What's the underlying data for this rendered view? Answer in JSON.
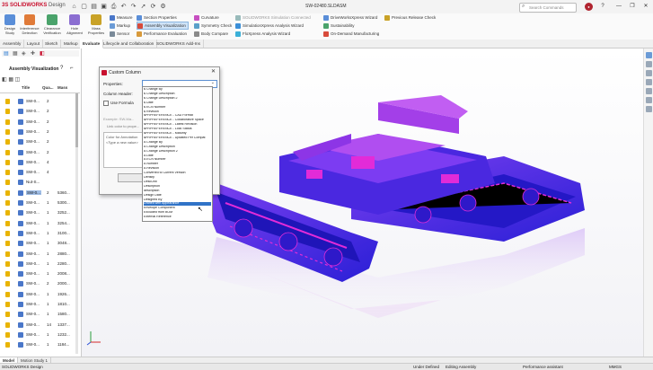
{
  "app": {
    "logo_ds": "3S",
    "logo_name": "SOLIDWORKS",
    "logo_suffix": "Design",
    "doc_title": "SW-02480.SLDASM",
    "search_placeholder": "Search Commands",
    "window_controls": [
      "—",
      "❐",
      "✕"
    ],
    "quick_icons": [
      "home-icon",
      "new-icon",
      "open-icon",
      "save-icon",
      "print-icon",
      "undo-icon",
      "redo-icon",
      "select-icon",
      "rebuild-icon",
      "options-icon"
    ]
  },
  "ribbon": {
    "big_buttons": [
      {
        "label": "Design Study",
        "color": "#5a8ed8"
      },
      {
        "label": "Interference Detection",
        "color": "#e07b39"
      },
      {
        "label": "Clearance Verification",
        "color": "#4aa36b"
      },
      {
        "label": "Hole Alignment",
        "color": "#8b6ed1"
      },
      {
        "label": "Mass Properties",
        "color": "#c9a227"
      }
    ],
    "col1": [
      "Measure",
      "Markup",
      "Sensor"
    ],
    "col2": [
      "Section Properties",
      "Assembly Visualization",
      "Performance Evaluation"
    ],
    "col3": [
      "Curvature",
      "Symmetry Check",
      "Body Compare"
    ],
    "col4": [
      "SOLIDWORKS Simulation Connected",
      "SimulationXpress Analysis Wizard",
      "FloXpress Analysis Wizard"
    ],
    "col5": [
      "DriveWorksXpress Wizard",
      "Sustainability",
      "On-Demand Manufacturing"
    ],
    "col6": [
      "Previous Release Check"
    ],
    "highlight": "Assembly Visualization"
  },
  "tabs": [
    "Assembly",
    "Layout",
    "Sketch",
    "Markup",
    "Evaluate",
    "Lifecycle and Collaboration",
    "SOLIDWORKS Add-Ins"
  ],
  "active_tab": "Evaluate",
  "left_panel": {
    "title": "Assembly Visualization",
    "headers": [
      "Title",
      "Qua...",
      "Mass"
    ],
    "rows": [
      {
        "name": "SW-0...",
        "qty": "2",
        "mass": ""
      },
      {
        "name": "SW-0...",
        "qty": "2",
        "mass": ""
      },
      {
        "name": "SW-0...",
        "qty": "2",
        "mass": ""
      },
      {
        "name": "SW-0...",
        "qty": "2",
        "mass": ""
      },
      {
        "name": "SW-0...",
        "qty": "2",
        "mass": ""
      },
      {
        "name": "SW-0...",
        "qty": "2",
        "mass": ""
      },
      {
        "name": "SW-0...",
        "qty": "4",
        "mass": ""
      },
      {
        "name": "SW-0...",
        "qty": "4",
        "mass": ""
      },
      {
        "name": "Nut-S...",
        "qty": "",
        "mass": ""
      },
      {
        "name": "SW-0...",
        "qty": "2",
        "mass": "5360..."
      },
      {
        "name": "SW-0...",
        "qty": "1",
        "mass": "5300..."
      },
      {
        "name": "SW-0...",
        "qty": "1",
        "mass": "3252..."
      },
      {
        "name": "SW-0...",
        "qty": "1",
        "mass": "3254..."
      },
      {
        "name": "SW-0...",
        "qty": "1",
        "mass": "3100..."
      },
      {
        "name": "SW-0...",
        "qty": "1",
        "mass": "3048..."
      },
      {
        "name": "SW-0...",
        "qty": "1",
        "mass": "2880..."
      },
      {
        "name": "SW-0...",
        "qty": "1",
        "mass": "2280..."
      },
      {
        "name": "SW-0...",
        "qty": "1",
        "mass": "2008..."
      },
      {
        "name": "SW-0...",
        "qty": "2",
        "mass": "2000..."
      },
      {
        "name": "SW-0...",
        "qty": "1",
        "mass": "1926..."
      },
      {
        "name": "SW-0...",
        "qty": "1",
        "mass": "1810..."
      },
      {
        "name": "SW-0...",
        "qty": "1",
        "mass": "1580..."
      },
      {
        "name": "SW-0...",
        "qty": "14",
        "mass": "1337..."
      },
      {
        "name": "SW-0...",
        "qty": "1",
        "mass": "1232..."
      },
      {
        "name": "SW-0...",
        "qty": "1",
        "mass": "1184..."
      }
    ],
    "selected_index": 9
  },
  "dialog": {
    "title": "Custom Column",
    "properties_label": "Properties:",
    "column_header_label": "Column Header:",
    "use_formula_label": "Use Formula",
    "grey_text_1": "Example: SW-Ma...",
    "grey_text_2": "Link color to prope...",
    "textarea_lines": [
      "Color for Annotation",
      "<Type a new value>"
    ]
  },
  "dropdown": {
    "items": [
      "$ Change By",
      "$ Change Description",
      "$ Change Description 2",
      "$ Date",
      "$ ECN Number",
      "$ Revision",
      "$PRPREFERENCE - CAD Format",
      "$PRPREFERENCE - Collaborative Space",
      "$PRPREFERENCE - Latest Revision",
      "$PRPREFERENCE - Lock Status",
      "$PRPREFERENCE - Maturity",
      "$PRPREFERENCE - Updated Per Compat",
      "A Change By",
      "A Change Description",
      "A Change Description 2",
      "A Date",
      "A ECN Number",
      "A Number",
      "A Revision",
      "Converted to Current Version",
      "Density",
      "DescUnit",
      "Description",
      "description",
      "Design Date",
      "Designed By",
      "Drafted with Appearance",
      "Envelope Component",
      "Excluded from BOM",
      "External Reference"
    ],
    "highlight_index": 26
  },
  "bottom_tabs": [
    "Model",
    "Motion Study 1"
  ],
  "status": {
    "app": "SOLIDWORKS Design",
    "under_defined": "Under Defined",
    "editing": "Editing Assembly",
    "perf": "Performance assistant",
    "units": "MMGS"
  },
  "colors": {
    "accent": "#c8102e",
    "model_blue": "#2a1fd6",
    "model_magenta": "#e22bd8",
    "selection": "#3073c7"
  }
}
